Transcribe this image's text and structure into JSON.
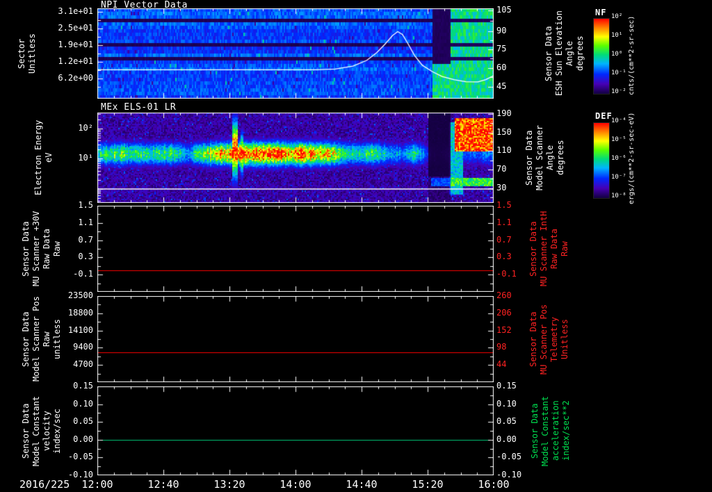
{
  "footer": {
    "date": "2016/225",
    "time_ticks": [
      "12:00",
      "12:40",
      "13:20",
      "14:00",
      "14:40",
      "15:20",
      "16:00"
    ]
  },
  "panels": [
    {
      "title": "NPI Vector Data",
      "left_label_lines": [
        "Sector",
        "Unitless"
      ],
      "yticks": [
        "3.1e+01",
        "2.5e+01",
        "1.9e+01",
        "1.2e+01",
        "6.2e+00"
      ],
      "right_ticks": [
        "105",
        "90",
        "75",
        "60",
        "45"
      ],
      "right_label_lines": [
        "Sensor Data",
        "ESH Sun Elevation",
        "Angle",
        "degrees"
      ],
      "colorbar": {
        "label": "NF",
        "ticks": [
          "10²",
          "10¹",
          "10⁰",
          "10⁻¹",
          "10⁻²"
        ],
        "units": "cnts/(cm**2-sr-sec)",
        "label_color": "#ffaa00"
      }
    },
    {
      "title": "MEx ELS-01 LR",
      "left_label_lines": [
        "Electron Energy",
        "eV"
      ],
      "yticks": [
        "10²",
        "10¹"
      ],
      "right_ticks": [
        "190",
        "150",
        "110",
        "70",
        "30"
      ],
      "right_label_lines": [
        "Sensor Data",
        "Model Scanner",
        "Angle",
        "degrees"
      ],
      "colorbar": {
        "label": "DEF",
        "ticks": [
          "10⁻⁴",
          "10⁻⁵",
          "10⁻⁶",
          "10⁻⁷",
          "10⁻⁸"
        ],
        "units": "ergs/(cm**2-sr-sec-eV)",
        "label_color": "#ff3300"
      }
    },
    {
      "left_label_lines": [
        "Sensor Data",
        "MU Scanner +30V",
        "Raw Data",
        "Raw"
      ],
      "yticks": [
        "1.5",
        "1.1",
        "0.7",
        "0.3",
        "-0.1"
      ],
      "right_ticks": [
        "1.5",
        "1.1",
        "0.7",
        "0.3",
        "-0.1"
      ],
      "right_label_lines": [
        "Sensor Data",
        "MU Scanner IntH",
        "Raw Data",
        "Raw"
      ]
    },
    {
      "left_label_lines": [
        "Sensor Data",
        "Model Scanner Pos",
        "Raw",
        "unitless"
      ],
      "yticks": [
        "23500",
        "18800",
        "14100",
        "9400",
        "4700"
      ],
      "right_ticks": [
        "260",
        "206",
        "152",
        "98",
        "44"
      ],
      "right_label_lines": [
        "Sensor Data",
        "MU Scanner Pos",
        "Telemetry",
        "Unitless"
      ]
    },
    {
      "left_label_lines": [
        "Sensor Data",
        "Model Constant",
        "velocity",
        "index/sec"
      ],
      "yticks": [
        "0.15",
        "0.10",
        "0.05",
        "0.00",
        "-0.05",
        "-0.10"
      ],
      "right_ticks": [
        "0.15",
        "0.10",
        "0.05",
        "0.00",
        "-0.05",
        "-0.10"
      ],
      "right_label_lines": [
        "Sensor Data",
        "Model Constant",
        "acceleration",
        "index/sec**2"
      ]
    }
  ],
  "chart_data": [
    {
      "id": "npi",
      "type": "heatmap",
      "title": "NPI Vector Data",
      "xlim_hours": [
        12,
        16
      ],
      "x_ticks": [
        "12:00",
        "12:40",
        "13:20",
        "14:00",
        "14:40",
        "15:20",
        "16:00"
      ],
      "y_axis": {
        "label": "Sector Unitless",
        "tick_values": [
          31,
          25,
          19,
          12,
          6.2
        ]
      },
      "right_axis": {
        "label": "Sensor Data ESH Sun Elevation Angle degrees",
        "tick_values": [
          105,
          90,
          75,
          60,
          45
        ]
      },
      "colormap": "rainbow",
      "colorbar": {
        "label": "NF",
        "units": "cnts/(cm**2-sr-sec)",
        "tick_values": [
          100,
          10,
          1,
          0.1,
          0.01
        ]
      },
      "heatmap": {
        "base": 0.28,
        "dark_row_bands": [
          [
            0.1,
            0.17
          ],
          [
            0.37,
            0.43
          ],
          [
            0.52,
            0.575
          ]
        ],
        "bright_x0": 0.845,
        "bright_amp": 0.5,
        "dark_col": [
          0.845,
          0.888
        ]
      },
      "overlay": {
        "name": "ESH Sun Elevation Angle",
        "color": "#ffffff",
        "flat_value_deg": 59,
        "peak_value_deg": 90,
        "peak_time": "15:03",
        "points_norm": [
          [
            0,
            0.68
          ],
          [
            0.55,
            0.68
          ],
          [
            0.6,
            0.672
          ],
          [
            0.645,
            0.64
          ],
          [
            0.68,
            0.575
          ],
          [
            0.705,
            0.49
          ],
          [
            0.725,
            0.4
          ],
          [
            0.745,
            0.3
          ],
          [
            0.758,
            0.258
          ],
          [
            0.77,
            0.29
          ],
          [
            0.785,
            0.4
          ],
          [
            0.8,
            0.52
          ],
          [
            0.82,
            0.63
          ],
          [
            0.845,
            0.7
          ],
          [
            0.87,
            0.755
          ],
          [
            0.9,
            0.79
          ],
          [
            0.93,
            0.812
          ],
          [
            0.96,
            0.815
          ],
          [
            0.98,
            0.79
          ],
          [
            1,
            0.745
          ]
        ]
      },
      "ticks": {
        "left_major": [
          0.04,
          0.225,
          0.41,
          0.595,
          0.78
        ],
        "left_minor": [
          0.1325,
          0.3175,
          0.5025,
          0.6875,
          0.8725
        ],
        "right_major": [
          0.02,
          0.25,
          0.455,
          0.66,
          0.87
        ],
        "right_minor": [
          0.135,
          0.3525,
          0.5575,
          0.765
        ]
      }
    },
    {
      "id": "els",
      "type": "heatmap",
      "title": "MEx ELS-01 LR",
      "xlim_hours": [
        12,
        16
      ],
      "y_axis": {
        "label": "Electron Energy eV",
        "scale": "log",
        "tick_values": [
          100,
          10
        ]
      },
      "right_axis": {
        "label": "Sensor Data Model Scanner Angle degrees",
        "tick_values": [
          190,
          150,
          110,
          70,
          30
        ]
      },
      "colormap": "rainbow",
      "colorbar": {
        "label": "DEF",
        "units": "ergs/(cm**2-sr-sec-eV)",
        "tick_values": [
          0.0001,
          1e-05,
          1e-06,
          1e-07,
          1e-08
        ]
      },
      "heatmap": {
        "band_center": 0.45,
        "band_sigma": 0.09,
        "envelope": [
          [
            0,
            0.55
          ],
          [
            0.06,
            0.62
          ],
          [
            0.12,
            0.55
          ],
          [
            0.17,
            0.6
          ],
          [
            0.23,
            0.4
          ],
          [
            0.27,
            0.65
          ],
          [
            0.3,
            0.8
          ],
          [
            0.33,
            0.9
          ],
          [
            0.36,
            1.0
          ],
          [
            0.4,
            0.92
          ],
          [
            0.44,
            0.96
          ],
          [
            0.48,
            0.9
          ],
          [
            0.52,
            0.93
          ],
          [
            0.56,
            0.85
          ],
          [
            0.6,
            0.7
          ],
          [
            0.63,
            0.55
          ],
          [
            0.67,
            0.5
          ],
          [
            0.7,
            0.6
          ],
          [
            0.73,
            0.45
          ],
          [
            0.77,
            0.35
          ],
          [
            0.8,
            0.55
          ],
          [
            0.825,
            0.3
          ],
          [
            0.86,
            0.15
          ],
          [
            0.9,
            0.3
          ],
          [
            0.95,
            0.3
          ],
          [
            1,
            0.35
          ]
        ],
        "streaks": [
          {
            "x": 0.345,
            "w": 0.006,
            "center": 0.4,
            "sigma": 0.22,
            "amp": 0.95
          },
          {
            "x": 0.362,
            "w": 0.004,
            "center": 0.45,
            "sigma": 0.15,
            "amp": 0.85
          }
        ],
        "blobs": [
          {
            "x0": 0.9,
            "x1": 1.0,
            "y0": 0.05,
            "y1": 0.42,
            "amp": 0.97
          },
          {
            "x0": 0.84,
            "x1": 1.0,
            "y0": 0.72,
            "y1": 0.8,
            "amp": 0.6
          },
          {
            "x0": 0.885,
            "x1": 0.92,
            "y0": 0.1,
            "y1": 0.9,
            "amp": 0.45
          }
        ],
        "dark_cols": [
          [
            0.832,
            0.888
          ]
        ]
      },
      "overlay": {
        "name": "Model Scanner Angle",
        "color": "#ffffff",
        "constant_value_deg": 20,
        "points_norm": [
          [
            0,
            0.846
          ],
          [
            1,
            0.846
          ]
        ]
      },
      "ticks": {
        "left_major": [
          0.177,
          0.51,
          0.843
        ],
        "left_minor": [
          0.018,
          0.077,
          0.192,
          0.209,
          0.228,
          0.251,
          0.277,
          0.31,
          0.351,
          0.41,
          0.525,
          0.542,
          0.561,
          0.584,
          0.61,
          0.643,
          0.684,
          0.743,
          0.858,
          0.875,
          0.896,
          0.917,
          0.943,
          0.976
        ],
        "right_major": [
          0.015,
          0.221,
          0.426,
          0.631,
          0.837
        ],
        "right_minor": [
          0.118,
          0.324,
          0.529,
          0.734,
          0.94
        ]
      }
    },
    {
      "id": "mu-scanner-30v",
      "type": "line",
      "ylim": [
        -0.5,
        1.5
      ],
      "ytick_values": [
        1.5,
        1.1,
        0.7,
        0.3,
        -0.1
      ],
      "right_tick_values": [
        1.5,
        1.1,
        0.7,
        0.3,
        -0.1
      ],
      "series": [
        {
          "name": "Sensor Data MU Scanner +30V Raw Data Raw",
          "value": 0.0,
          "color": "#ff0000"
        }
      ],
      "ticks": {
        "left_major": [
          0,
          0.2,
          0.4,
          0.6,
          0.8
        ],
        "left_minor": [
          0.1,
          0.3,
          0.5,
          0.7,
          0.9
        ],
        "right_major": [
          0,
          0.2,
          0.4,
          0.6,
          0.8
        ],
        "right_minor": [
          0.1,
          0.3,
          0.5,
          0.7,
          0.9
        ]
      }
    },
    {
      "id": "model-scanner-pos",
      "type": "line",
      "ylim": [
        0,
        23500
      ],
      "ytick_values": [
        23500,
        18800,
        14100,
        9400,
        4700
      ],
      "right_tick_values": [
        260,
        206,
        152,
        98,
        44
      ],
      "series": [
        {
          "name": "Sensor Data Model Scanner Pos Raw unitless",
          "value": 8200,
          "color": "#ff0000"
        }
      ],
      "ticks": {
        "left_major": [
          0,
          0.2,
          0.4,
          0.6,
          0.8
        ],
        "left_minor": [
          0.1,
          0.3,
          0.5,
          0.7,
          0.9
        ],
        "right_major": [
          0,
          0.2,
          0.4,
          0.6,
          0.8
        ],
        "right_minor": [
          0.1,
          0.3,
          0.5,
          0.7,
          0.9
        ]
      }
    },
    {
      "id": "model-constant-velocity",
      "type": "line",
      "ylim": [
        -0.1,
        0.15
      ],
      "ytick_values": [
        0.15,
        0.1,
        0.05,
        0.0,
        -0.05,
        -0.1
      ],
      "right_tick_values": [
        0.15,
        0.1,
        0.05,
        0.0,
        -0.05,
        -0.1
      ],
      "series": [
        {
          "name": "Sensor Data Model Constant velocity index/sec",
          "value": 0.0,
          "color": "#00c878"
        }
      ],
      "ticks": {
        "left_major": [
          0,
          0.2,
          0.4,
          0.6,
          0.8,
          1
        ],
        "left_minor": [
          0.1,
          0.3,
          0.5,
          0.7,
          0.9
        ],
        "right_major": [
          0,
          0.2,
          0.4,
          0.6,
          0.8,
          1
        ],
        "right_minor": [
          0.1,
          0.3,
          0.5,
          0.7,
          0.9
        ]
      }
    }
  ]
}
